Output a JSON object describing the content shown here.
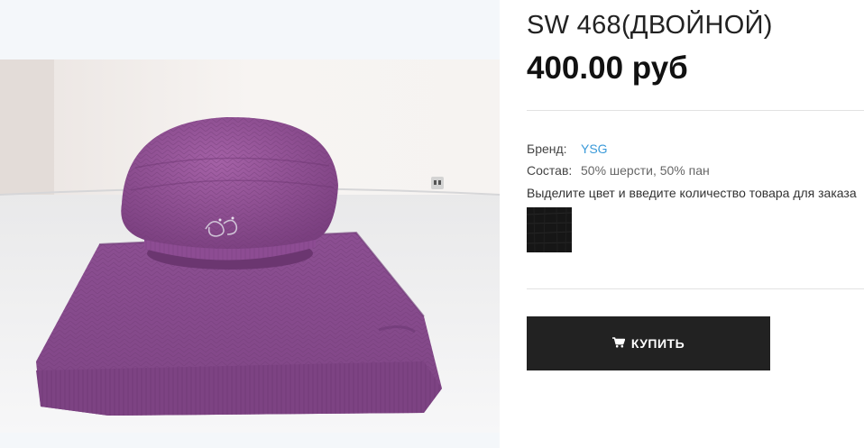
{
  "product": {
    "title": "SW 468(ДВОЙНОЙ)",
    "price": "400.00 руб",
    "image_alt": "purple knitted beret and scarf set"
  },
  "specs": {
    "brand_label": "Бренд:",
    "brand_value": "YSG",
    "composition_label": "Состав:",
    "composition_value": "50% шерсти, 50% пан"
  },
  "color_hint": "Выделите цвет и введите количество товара для заказа",
  "color_swatch": {
    "color": "#161616"
  },
  "buy_button": {
    "label": "КУПИТЬ",
    "icon": "cart-icon"
  },
  "colors": {
    "brand_link": "#3a9ad9",
    "button_bg": "#222222",
    "product_purple": "#8e4f94"
  }
}
